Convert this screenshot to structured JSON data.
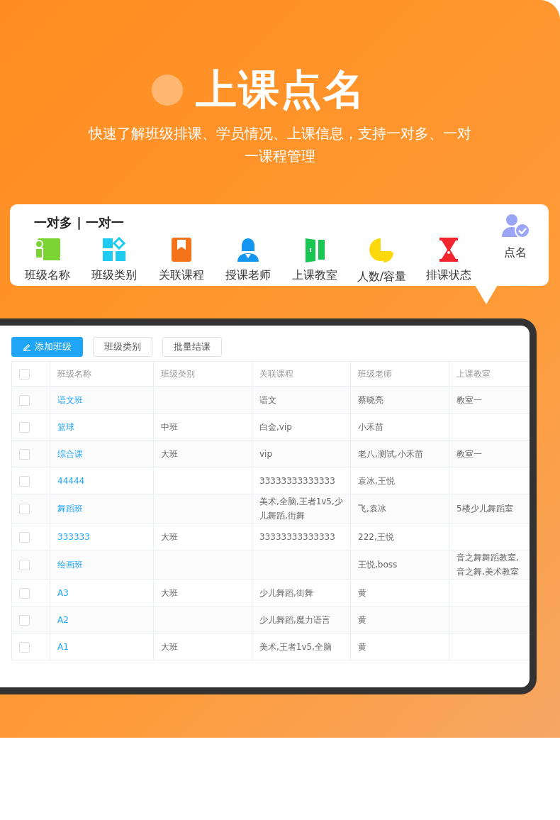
{
  "hero": {
    "title": "上课点名",
    "subtitle": "快速了解班级排课、学员情况、上课信息，支持一对多、一对一课程管理"
  },
  "feature_card": {
    "heading": "一对多 | 一对一",
    "items": [
      {
        "label": "班级名称",
        "kind": "field"
      },
      {
        "label": "班级类别",
        "kind": "field"
      },
      {
        "label": "关联课程",
        "kind": "field"
      },
      {
        "label": "授课老师",
        "kind": "field"
      },
      {
        "label": "上课教室",
        "kind": "field"
      },
      {
        "label": "人数/容量",
        "kind": "field"
      },
      {
        "label": "排课状态",
        "kind": "field"
      },
      {
        "label": "点名",
        "kind": "action"
      }
    ]
  },
  "toolbar": {
    "buttons": [
      {
        "label": "添加班级",
        "kind": "primary"
      },
      {
        "label": "班级类别",
        "kind": "plain"
      },
      {
        "label": "批量结课",
        "kind": "plain"
      }
    ]
  },
  "table": {
    "select_all": {
      "checked": false
    },
    "columns": [
      "班级名称",
      "班级类别",
      "关联课程",
      "班级老师",
      "上课教室"
    ],
    "rows": [
      {
        "checked": false,
        "cells": [
          "语文班",
          "",
          "语文",
          "蔡晓亮",
          "教室一"
        ]
      },
      {
        "checked": false,
        "cells": [
          "篮球",
          "中班",
          "白金,vip",
          "小禾苗",
          ""
        ]
      },
      {
        "checked": false,
        "cells": [
          "综合课",
          "大班",
          "vip",
          "老八,测试,小禾苗",
          "教室一"
        ]
      },
      {
        "checked": false,
        "cells": [
          "44444",
          "",
          "33333333333333",
          "袁冰,王悦",
          ""
        ]
      },
      {
        "checked": false,
        "cells": [
          "舞蹈班",
          "",
          "美术,全脑,王者1v5,少儿舞蹈,街舞",
          "飞,袁冰",
          "5楼少儿舞蹈室"
        ]
      },
      {
        "checked": false,
        "cells": [
          "333333",
          "大班",
          "33333333333333",
          "222,王悦",
          ""
        ]
      },
      {
        "checked": false,
        "cells": [
          "绘画班",
          "",
          "",
          "王悦,boss",
          "音之舞舞蹈教室,音之舞,美术教室"
        ]
      },
      {
        "checked": false,
        "cells": [
          "A3",
          "大班",
          "少儿舞蹈,街舞",
          "黄",
          ""
        ]
      },
      {
        "checked": false,
        "cells": [
          "A2",
          "",
          "少儿舞蹈,魔力语言",
          "黄",
          ""
        ]
      },
      {
        "checked": false,
        "cells": [
          "A1",
          "大班",
          "美术,王者1v5,全脑",
          "黄",
          ""
        ]
      }
    ]
  }
}
